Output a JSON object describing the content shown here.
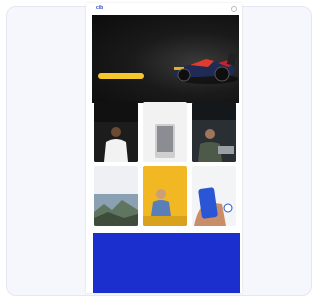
{
  "nav": {
    "logo_text": "cib",
    "menu_icon": "search-icon"
  },
  "hero": {
    "eyebrow": "",
    "title": "",
    "cta_label": ""
  },
  "tiles": [
    {
      "title": "",
      "subtitle": ""
    },
    {
      "title": "",
      "subtitle": ""
    },
    {
      "title": "",
      "subtitle": ""
    },
    {
      "title": "",
      "subtitle": ""
    },
    {
      "title": "",
      "subtitle": ""
    },
    {
      "title": "",
      "subtitle": ""
    }
  ],
  "colors": {
    "brand": "#2a4cc4",
    "hero_bg": "#111111",
    "cta": "#f6c72b",
    "footer": "#1b2fcf"
  }
}
